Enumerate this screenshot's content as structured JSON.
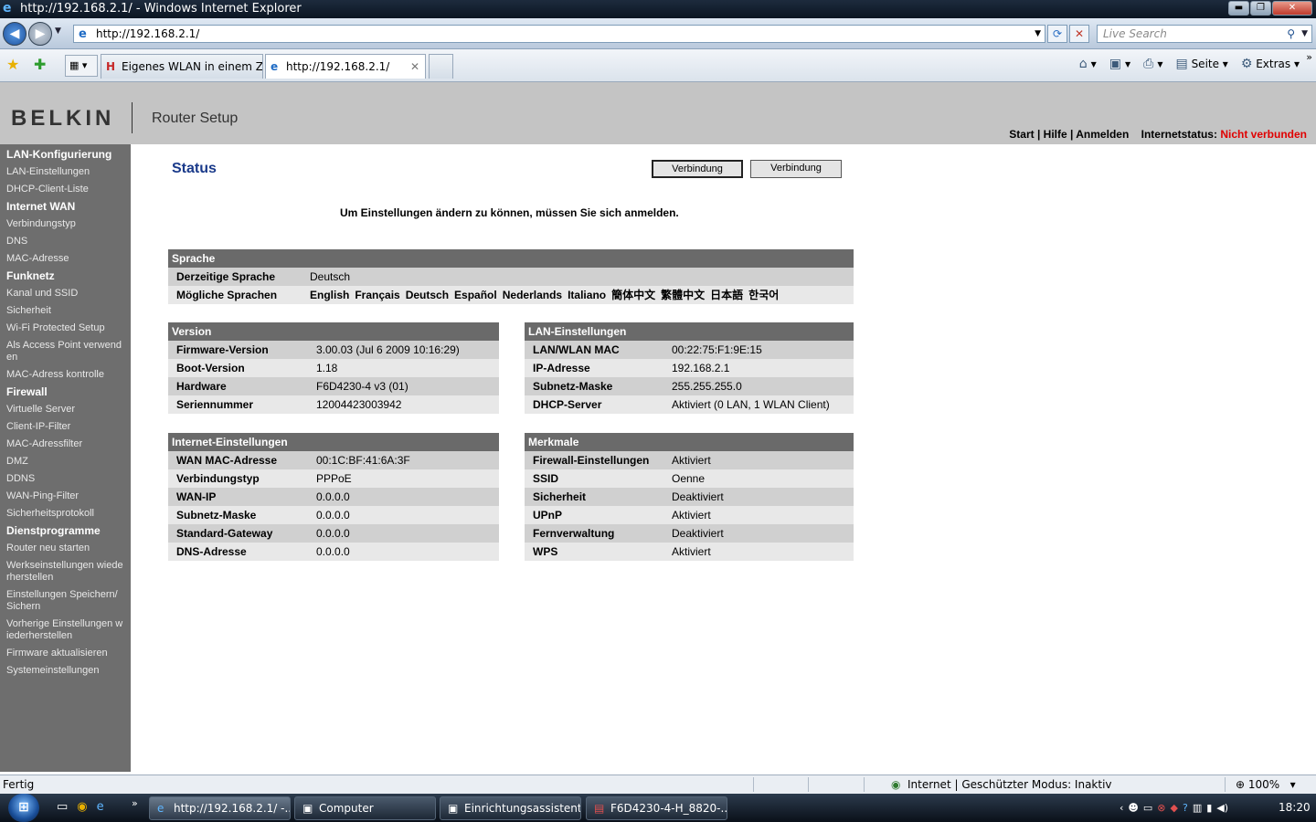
{
  "window": {
    "title": "http://192.168.2.1/ - Windows Internet Explorer",
    "minimize": "▬",
    "restore": "❐",
    "close": "✕"
  },
  "address": {
    "url": "http://192.168.2.1/",
    "search_placeholder": "Live Search"
  },
  "tabs": {
    "tab1": "Eigenes WLAN in einem Zi...",
    "tab2": "http://192.168.2.1/"
  },
  "toolbar": {
    "page_menu": "Seite",
    "tools_menu": "Extras"
  },
  "header": {
    "logo": "BELKIN",
    "product": "Router Setup",
    "link_start": "Start",
    "link_help": "Hilfe",
    "link_login": "Anmelden",
    "internet_status_label": "Internetstatus:",
    "internet_status_value": "Nicht verbunden",
    "status_color": "#e00000"
  },
  "sidebar": {
    "items": [
      {
        "label": "LAN-Konfigurierung",
        "type": "section"
      },
      {
        "label": "LAN-Einstellungen",
        "type": "item"
      },
      {
        "label": "DHCP-Client-Liste",
        "type": "item"
      },
      {
        "label": "Internet WAN",
        "type": "section"
      },
      {
        "label": "Verbindungstyp",
        "type": "item"
      },
      {
        "label": "DNS",
        "type": "item"
      },
      {
        "label": "MAC-Adresse",
        "type": "item"
      },
      {
        "label": "Funknetz",
        "type": "section"
      },
      {
        "label": "Kanal und SSID",
        "type": "item"
      },
      {
        "label": "Sicherheit",
        "type": "item"
      },
      {
        "label": "Wi-Fi Protected Setup",
        "type": "item"
      },
      {
        "label": "Als Access Point verwenden",
        "type": "item"
      },
      {
        "label": "MAC-Adress kontrolle",
        "type": "item"
      },
      {
        "label": "Firewall",
        "type": "section"
      },
      {
        "label": "Virtuelle Server",
        "type": "item"
      },
      {
        "label": "Client-IP-Filter",
        "type": "item"
      },
      {
        "label": "MAC-Adressfilter",
        "type": "item"
      },
      {
        "label": "DMZ",
        "type": "item"
      },
      {
        "label": "DDNS",
        "type": "item"
      },
      {
        "label": "WAN-Ping-Filter",
        "type": "item"
      },
      {
        "label": "Sicherheitsprotokoll",
        "type": "item"
      },
      {
        "label": "Dienstprogramme",
        "type": "section"
      },
      {
        "label": "Router neu starten",
        "type": "item"
      },
      {
        "label": "Werkseinstellungen wiederherstellen",
        "type": "item"
      },
      {
        "label": "Einstellungen Speichern/Sichern",
        "type": "item"
      },
      {
        "label": "Vorherige Einstellungen wiederherstellen",
        "type": "item"
      },
      {
        "label": "Firmware aktualisieren",
        "type": "item"
      },
      {
        "label": "Systemeinstellungen",
        "type": "item"
      }
    ]
  },
  "main": {
    "title": "Status",
    "button1": "Verbindung",
    "button2": "Verbindung",
    "login_note": "Um Einstellungen ändern zu können, müssen Sie sich anmelden."
  },
  "language": {
    "header": "Sprache",
    "current_label": "Derzeitige Sprache",
    "current_value": "Deutsch",
    "available_label": "Mögliche Sprachen",
    "available": [
      "English",
      "Français",
      "Deutsch",
      "Español",
      "Nederlands",
      "Italiano",
      "簡体中文",
      "繁體中文",
      "日本語",
      "한국어"
    ]
  },
  "version": {
    "header": "Version",
    "rows": [
      {
        "k": "Firmware-Version",
        "v": "3.00.03 (Jul 6 2009 10:16:29)"
      },
      {
        "k": "Boot-Version",
        "v": "1.18"
      },
      {
        "k": "Hardware",
        "v": "F6D4230-4 v3 (01)"
      },
      {
        "k": "Seriennummer",
        "v": "12004423003942"
      }
    ]
  },
  "lan": {
    "header": "LAN-Einstellungen",
    "rows": [
      {
        "k": "LAN/WLAN MAC",
        "v": "00:22:75:F1:9E:15"
      },
      {
        "k": "IP-Adresse",
        "v": "192.168.2.1"
      },
      {
        "k": "Subnetz-Maske",
        "v": "255.255.255.0"
      },
      {
        "k": "DHCP-Server",
        "v": "Aktiviert (0 LAN, 1 WLAN Client)"
      }
    ]
  },
  "internet": {
    "header": "Internet-Einstellungen",
    "rows": [
      {
        "k": "WAN MAC-Adresse",
        "v": "00:1C:BF:41:6A:3F"
      },
      {
        "k": "Verbindungstyp",
        "v": "PPPoE"
      },
      {
        "k": "WAN-IP",
        "v": "0.0.0.0"
      },
      {
        "k": "Subnetz-Maske",
        "v": "0.0.0.0"
      },
      {
        "k": "Standard-Gateway",
        "v": "0.0.0.0"
      },
      {
        "k": "DNS-Adresse",
        "v": "0.0.0.0"
      }
    ]
  },
  "features": {
    "header": "Merkmale",
    "rows": [
      {
        "k": "Firewall-Einstellungen",
        "v": "Aktiviert"
      },
      {
        "k": "SSID",
        "v": "Oenne"
      },
      {
        "k": "Sicherheit",
        "v": "Deaktiviert"
      },
      {
        "k": "UPnP",
        "v": "Aktiviert"
      },
      {
        "k": "Fernverwaltung",
        "v": "Deaktiviert"
      },
      {
        "k": "WPS",
        "v": "Aktiviert"
      }
    ]
  },
  "statusbar": {
    "text": "Fertig",
    "zone": "Internet | Geschützter Modus: Inaktiv",
    "zoom": "100%"
  },
  "taskbar": {
    "tasks": [
      "http://192.168.2.1/ -...",
      "Computer",
      "Einrichtungsassistent",
      "F6D4230-4-H_8820-..."
    ],
    "clock": "18:20"
  }
}
